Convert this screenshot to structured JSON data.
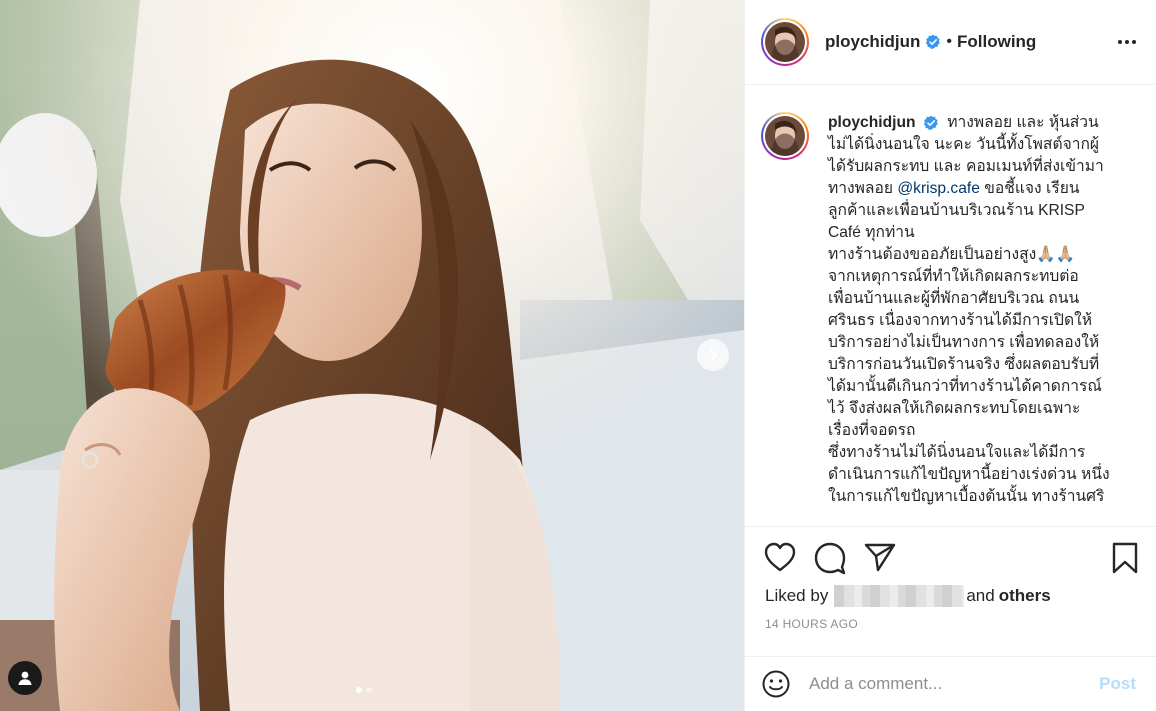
{
  "post": {
    "username": "ploychidjun",
    "follow_state": "Following",
    "more_options_icon": "more-horizontal-icon",
    "image_count": 2,
    "active_image_index": 1
  },
  "caption": {
    "username": "ploychidjun",
    "lines": [
      "ทางพลอย และ หุ้นส่วน",
      "ไม่ได้นิ่งนอนใจ นะคะ วันนี้ทั้งโพสต์จากผู้",
      "ได้รับผลกระทบ และ คอมเมนท์ที่ส่งเข้ามา",
      "ทางพลอย",
      "@krisp.cafe",
      "ขอชี้แจง เรียน",
      "ลูกค้าและเพื่อนบ้านบริเวณร้าน KRISP",
      "Café ทุกท่าน",
      "ทางร้านต้องขออภัยเป็นอย่างสูง🙏🏼🙏🏼",
      "จากเหตุการณ์ที่ทำให้เกิดผลกระทบต่อ",
      "เพื่อนบ้านและผู้ที่พักอาศัยบริเวณ ถนน",
      "ศรินธร เนื่องจากทางร้านได้มีการเปิดให้",
      "บริการอย่างไม่เป็นทางการ เพื่อทดลองให้",
      "บริการก่อนวันเปิดร้านจริง ซึ่งผลตอบรับที่",
      "ได้มานั้นดีเกินกว่าที่ทางร้านได้คาดการณ์",
      "ไว้ จึงส่งผลให้เกิดผลกระทบโดยเฉพาะ",
      "เรื่องที่จอดรถ",
      "ซึ่งทางร้านไม่ได้นิ่งนอนใจและได้มีการ",
      "ดำเนินการแก้ไขปัญหานี้อย่างเร่งด่วน หนึ่ง",
      "ในการแก้ไขปัญหาเบื้องต้นนั้น ทางร้านศริ"
    ]
  },
  "actions": {
    "like_icon": "heart-icon",
    "comment_icon": "comment-icon",
    "share_icon": "send-icon",
    "save_icon": "bookmark-icon"
  },
  "likes": {
    "prefix": "Liked by",
    "middle": "and",
    "suffix": "others"
  },
  "timestamp": "14 HOURS AGO",
  "comment_box": {
    "placeholder": "Add a comment...",
    "post_label": "Post",
    "emoji_icon": "smiley-icon"
  },
  "colors": {
    "verified": "#3897f0",
    "post_disabled": "#b2dffc",
    "mention": "#00376b",
    "meta_gray": "#8e8e8e"
  }
}
